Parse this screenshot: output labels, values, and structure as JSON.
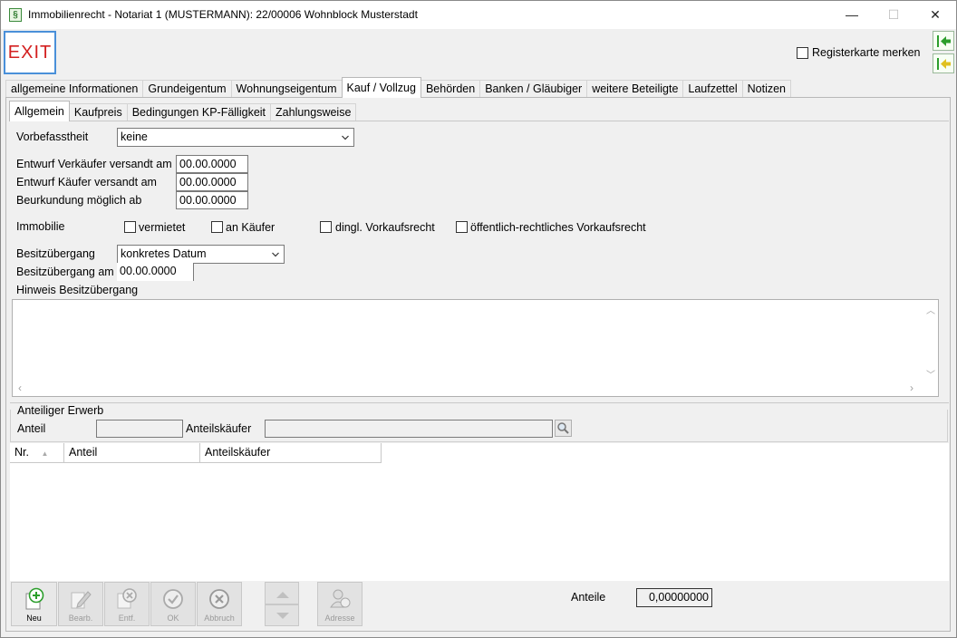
{
  "window": {
    "title": "Immobilienrecht - Notariat 1 (MUSTERMANN): 22/00006 Wohnblock Musterstadt",
    "app_icon_glyph": "§",
    "controls": {
      "minimize": "—",
      "maximize": "☐",
      "close": "✕"
    }
  },
  "toolbar": {
    "exit_label": "EXIT",
    "register_label": "Registerkarte merken",
    "register_checked": false
  },
  "main_tabs": [
    "allgemeine Informationen",
    "Grundeigentum",
    "Wohnungseigentum",
    "Kauf / Vollzug",
    "Behörden",
    "Banken / Gläubiger",
    "weitere Beteiligte",
    "Laufzettel",
    "Notizen"
  ],
  "main_tab_active": "Kauf / Vollzug",
  "sub_tabs": [
    "Allgemein",
    "Kaufpreis",
    "Bedingungen KP-Fälligkeit",
    "Zahlungsweise"
  ],
  "sub_tab_active": "Allgemein",
  "form": {
    "vorbefasstheit_label": "Vorbefasstheit",
    "vorbefasstheit_value": "keine",
    "entwurf_verkaeufer_label": "Entwurf Verkäufer versandt am",
    "entwurf_verkaeufer_value": "00.00.0000",
    "entwurf_kaeufer_label": "Entwurf Käufer versandt am",
    "entwurf_kaeufer_value": "00.00.0000",
    "beurkundung_label": "Beurkundung möglich ab",
    "beurkundung_value": "00.00.0000",
    "immobilie_label": "Immobilie",
    "checkboxes": {
      "vermietet": "vermietet",
      "an_kaeufer": "an Käufer",
      "dingl": "dingl. Vorkaufsrecht",
      "oeffentlich": "öffentlich-rechtliches Vorkaufsrecht"
    },
    "besitzuebergang_label": "Besitzübergang",
    "besitzuebergang_value": "konkretes Datum",
    "besitzuebergang_am_label": "Besitzübergang am",
    "besitzuebergang_am_value": "00.00.0000",
    "hinweis_label": "Hinweis Besitzübergang",
    "hinweis_value": ""
  },
  "anteiliger_erwerb": {
    "group_label": "Anteiliger Erwerb",
    "anteil_label": "Anteil",
    "anteil_value": "",
    "anteilskaeufer_label": "Anteilskäufer",
    "anteilskaeufer_value": ""
  },
  "grid": {
    "columns": [
      "Nr.",
      "Anteil",
      "Anteilskäufer"
    ],
    "sort_indicator": "▲",
    "rows": []
  },
  "bottom_toolbar": {
    "buttons": [
      {
        "label": "Neu",
        "icon": "plus-icon",
        "enabled": true
      },
      {
        "label": "Bearb.",
        "icon": "pencil-icon",
        "enabled": false
      },
      {
        "label": "Entf.",
        "icon": "delete-icon",
        "enabled": false
      },
      {
        "label": "OK",
        "icon": "check-icon",
        "enabled": false
      },
      {
        "label": "Abbruch",
        "icon": "cancel-icon",
        "enabled": false
      },
      {
        "label": "Adresse",
        "icon": "address-icon",
        "enabled": false
      }
    ],
    "anteile_label": "Anteile",
    "anteile_value": "0,00000000"
  },
  "colors": {
    "exit_text": "#d32020",
    "exit_border": "#4a90d9",
    "nav_arrow": "#2c9e2c"
  }
}
